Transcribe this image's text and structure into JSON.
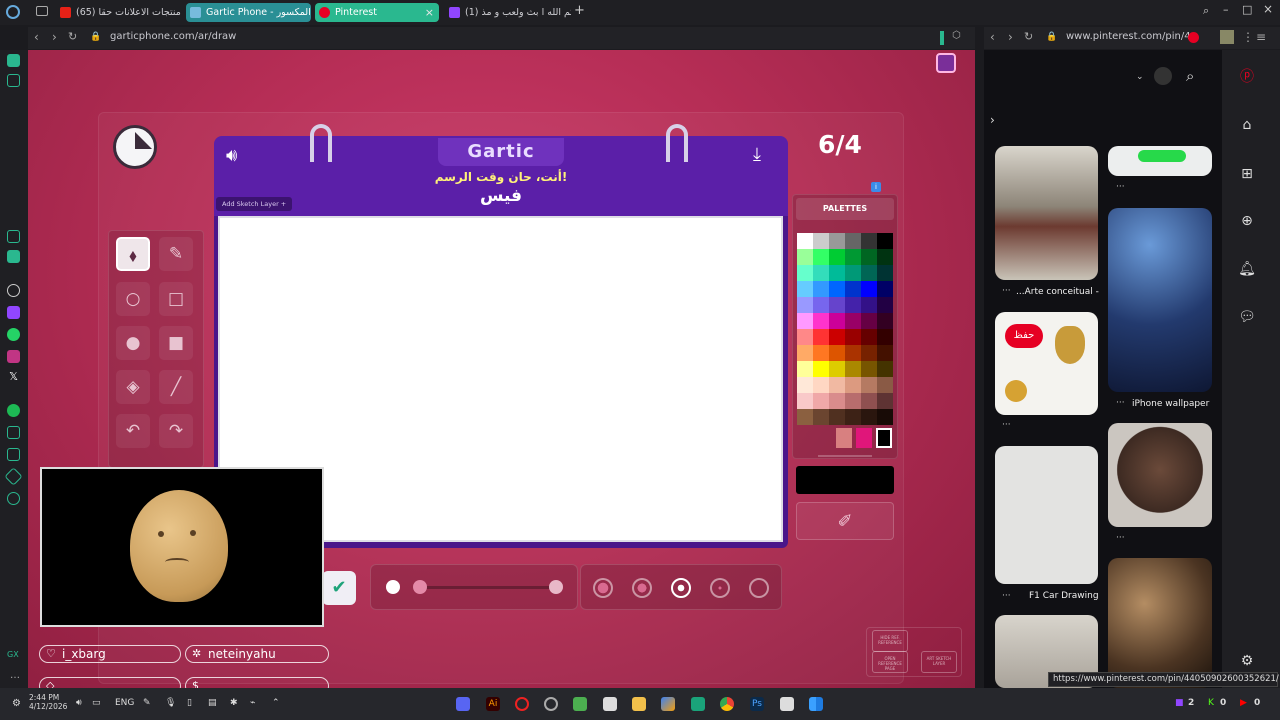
{
  "tabs": [
    {
      "label": "(65) هل منتجات الاعلانات حقا",
      "active": false
    },
    {
      "label": "Gartic Phone - الهاتف المكسور",
      "active": false
    },
    {
      "label": "Pinterest",
      "active": true
    },
    {
      "label": "(1) حياكم الله ا بث ولعب و مذ",
      "active": false
    }
  ],
  "address_left": "garticphone.com/ar/draw",
  "address_right": "www.pinterest.com/pin/4",
  "gartic": {
    "logo": "Gartic",
    "prompt_line1": "أنت، حان وقت الرسم!",
    "prompt_line2": "فيس",
    "add_sketch_layer": "Add Sketch Layer +",
    "round_counter": "6/4",
    "palettes_title": "PALETTES",
    "info": "i",
    "current_color": "#000000",
    "brush_fill": 0.0,
    "mini_buttons": [
      "HIDE REF. REFERENCE",
      "OPEN REFERENCE PAGE",
      "ART SKETCH LAYER"
    ]
  },
  "palette": [
    "#ffffff",
    "#cccccc",
    "#999999",
    "#666666",
    "#333333",
    "#000000",
    "#99ff99",
    "#33ff66",
    "#00cc33",
    "#009933",
    "#006622",
    "#003311",
    "#66ffcc",
    "#33ddbb",
    "#00bb99",
    "#009977",
    "#006655",
    "#003333",
    "#66ccff",
    "#3399ff",
    "#0066ff",
    "#0033cc",
    "#0000ff",
    "#000066",
    "#9999ff",
    "#7766ee",
    "#6644cc",
    "#4422aa",
    "#331188",
    "#220044",
    "#ff99ff",
    "#ff33cc",
    "#cc0099",
    "#990066",
    "#660044",
    "#330022",
    "#ff8888",
    "#ff3333",
    "#cc0000",
    "#990000",
    "#660000",
    "#330000",
    "#ffaa66",
    "#ff7722",
    "#dd5500",
    "#aa3300",
    "#772200",
    "#441100",
    "#ffff99",
    "#ffff00",
    "#ddcc00",
    "#aa8800",
    "#775500",
    "#443300",
    "#ffe8d8",
    "#ffd7c3",
    "#f1b9a2",
    "#dc9a80",
    "#b57a62",
    "#8a5a45",
    "#f9c9c9",
    "#f0a8a8",
    "#d98c8c",
    "#b86d6d",
    "#8f5050",
    "#5e3333",
    "#8b6040",
    "#6b4530",
    "#503020",
    "#3d2216",
    "#2a160e",
    "#180b06"
  ],
  "recent_colors": [
    "#d88080",
    "#e0167a",
    "#000000"
  ],
  "chat": {
    "user1": "i_xbarg",
    "user2": "neteinyahu",
    "input1": "",
    "input2": ""
  },
  "pinterest": {
    "captions": [
      "...Arte conceitual -",
      "iPhone wallpaper",
      "F1 Car Drawing"
    ],
    "save_button": "حفظ"
  },
  "status_url": "https://www.pinterest.com/pin/44050902600352621/",
  "taskbar": {
    "time": "2:44 PM",
    "date": "4/12/2026",
    "lang": "ENG",
    "badge1": "2",
    "badge2": "0",
    "badge3": "0"
  }
}
